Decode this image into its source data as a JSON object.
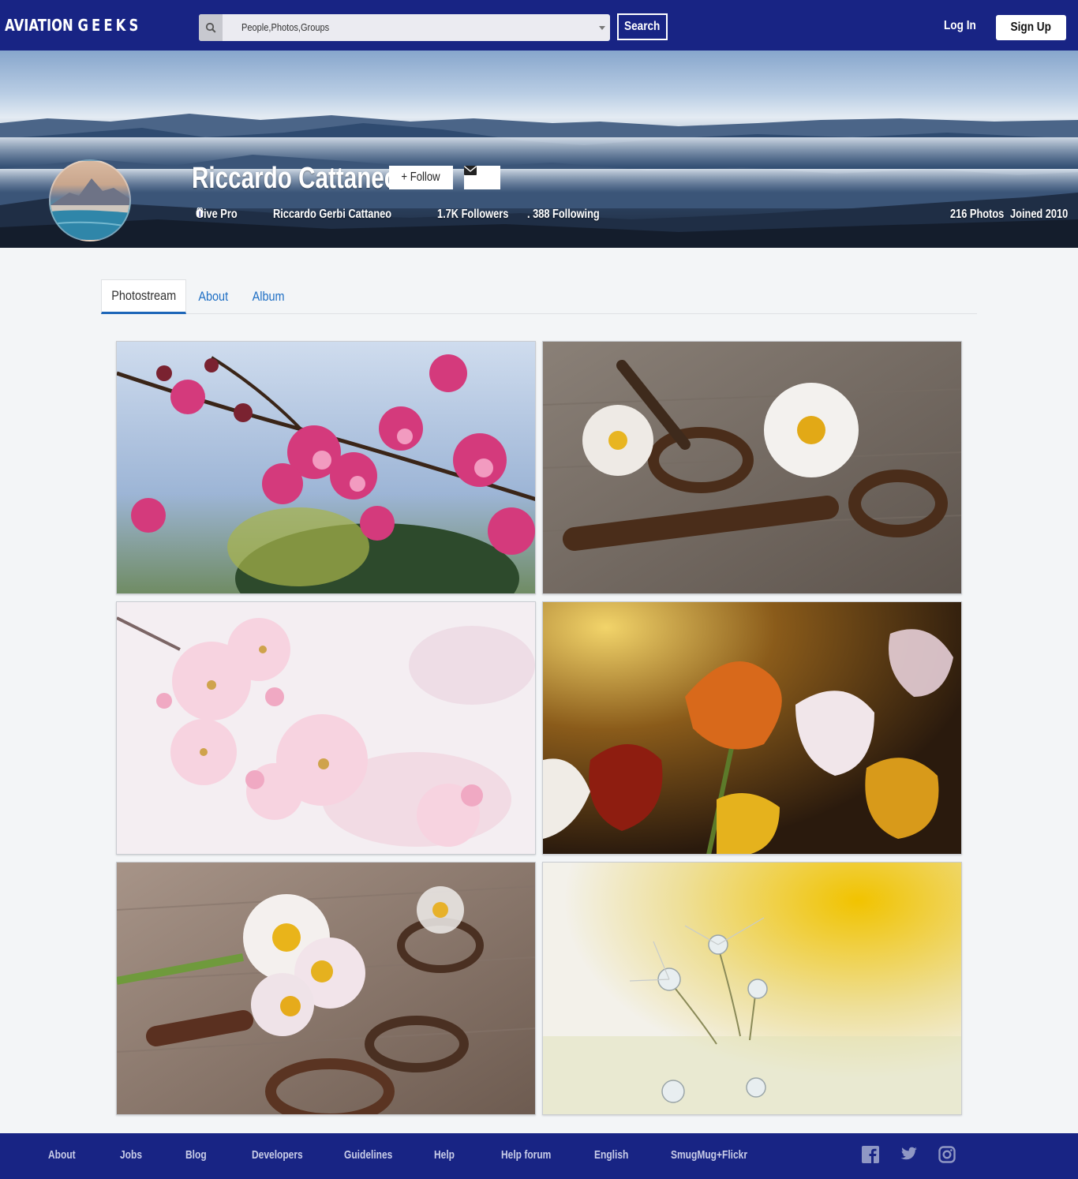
{
  "header": {
    "logo_prefix": "AVIATION ",
    "logo_suffix": "GEEKS",
    "search_value": "People,Photos,Groups",
    "search_button": "Search",
    "login": "Log In",
    "signup": "Sign Up"
  },
  "profile": {
    "name": "Riccardo Cattaneo",
    "follow_label": "+ Follow",
    "give_pro": "Give Pro",
    "real_name": "Riccardo Gerbi Cattaneo",
    "followers": "1.7K Followers",
    "following": ". 388 Following",
    "photos": "216 Photos",
    "joined": "Joined 2010"
  },
  "tabs": [
    {
      "label": "Photostream",
      "active": true
    },
    {
      "label": "About",
      "active": false
    },
    {
      "label": "Album",
      "active": false
    }
  ],
  "photos": [
    {
      "subject": "pink crabapple blossoms"
    },
    {
      "subject": "daisies with old keys"
    },
    {
      "subject": "pale pink cherry blossoms"
    },
    {
      "subject": "tulips in warm light"
    },
    {
      "subject": "daisy bouquet with keys"
    },
    {
      "subject": "dandelion seeds with droplets"
    }
  ],
  "footer": {
    "links": [
      "About",
      "Jobs",
      "Blog",
      "Developers",
      "Guidelines",
      "Help",
      "Help forum",
      "English",
      "SmugMug+Flickr"
    ],
    "social_icons": [
      "facebook-icon",
      "twitter-icon",
      "instagram-icon"
    ]
  },
  "colors": {
    "nav_bg": "#182484",
    "link_blue": "#1f6fc4",
    "page_bg": "#f3f5f7"
  }
}
